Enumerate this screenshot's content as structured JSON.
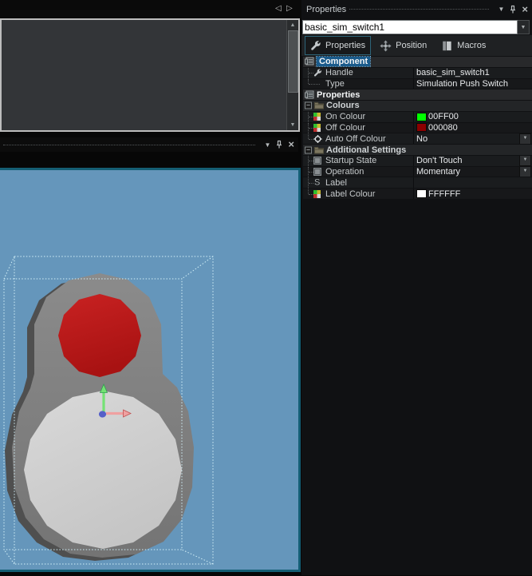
{
  "icons": {
    "prev": "◁",
    "next": "▷",
    "menu": "▼",
    "close": "×",
    "scroll_up": "▲",
    "scroll_down": "▼",
    "dropdown": "▼",
    "collapse": "−"
  },
  "viewport": {
    "bg": "#6596BB",
    "border_color": "#145E74",
    "selection_color": "#D2F0F8",
    "shadow_color": "#4F4F4F",
    "body_top": "#8B8B8B",
    "body_bottom": "#747474",
    "button_top": "#C92222",
    "button_bottom": "#A81212",
    "base_top": "#D9D9D9",
    "base_bottom": "#C5C5C5",
    "axis_y_shaft": "#74E274",
    "axis_y_edge": "#2F9E4F",
    "axis_x_shaft": "#EFA0A0",
    "axis_x_edge": "#C05050",
    "origin_dot": "#5560C8"
  },
  "properties_panel": {
    "title": "Properties",
    "name_input": {
      "value": "basic_sim_switch1"
    },
    "tabs": [
      {
        "label": "Properties",
        "selected": true
      },
      {
        "label": "Position",
        "selected": false
      },
      {
        "label": "Macros",
        "selected": false
      }
    ],
    "rows": [
      {
        "type": "section",
        "label": "Component",
        "selected": true
      },
      {
        "type": "item",
        "label": "Handle",
        "value": "basic_sim_switch1"
      },
      {
        "type": "item",
        "label": "Type",
        "value": "Simulation Push Switch"
      },
      {
        "type": "section",
        "label": "Properties"
      },
      {
        "type": "group",
        "label": "Colours"
      },
      {
        "type": "item",
        "label": "On Colour",
        "value": "00FF00",
        "swatch": "#00FF00"
      },
      {
        "type": "item",
        "label": "Off Colour",
        "value": "000080",
        "swatch": "#8B0000"
      },
      {
        "type": "item",
        "label": "Auto Off Colour",
        "value": "No",
        "dropdown": true
      },
      {
        "type": "group",
        "label": "Additional Settings"
      },
      {
        "type": "item",
        "label": "Startup State",
        "value": "Don't Touch",
        "dropdown": true
      },
      {
        "type": "item",
        "label": "Operation",
        "value": "Momentary",
        "dropdown": true
      },
      {
        "type": "item",
        "label": "Label",
        "value": ""
      },
      {
        "type": "item",
        "label": "Label Colour",
        "value": "FFFFFF",
        "swatch": "#FFFFFF"
      }
    ]
  }
}
